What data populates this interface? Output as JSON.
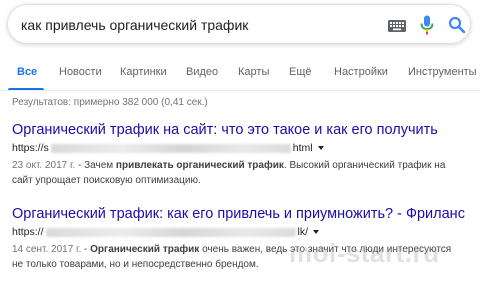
{
  "search": {
    "query": "как привлечь органический трафик",
    "icons": [
      "keyboard-icon",
      "microphone-icon",
      "search-icon"
    ]
  },
  "tabs": [
    {
      "label": "Все",
      "active": true
    },
    {
      "label": "Новости"
    },
    {
      "label": "Картинки"
    },
    {
      "label": "Видео"
    },
    {
      "label": "Карты"
    },
    {
      "label": "Ещё"
    },
    {
      "label": "Настройки"
    },
    {
      "label": "Инструменты"
    }
  ],
  "stats": "Результатов: примерно 382 000 (0,41 сек.)",
  "results": [
    {
      "title": "Органический трафик на сайт: что это такое и как его получить",
      "url_start": "https://s",
      "url_end": "html",
      "date": "23 окт. 2017 г.",
      "snippet_pre": " - Зачем ",
      "snippet_bold": "привлекать органический трафик",
      "snippet_post": ". Высокий органический трафик на сайт упрощает поисковую оптимизацию."
    },
    {
      "title": "Органический трафик: как его привлечь и приумножить? - Фриланс",
      "url_start": "https://",
      "url_end": "lk/",
      "date": "14 сент. 2017 г.",
      "snippet_pre": " - ",
      "snippet_bold": "Органический трафик",
      "snippet_post": " очень важен, ведь это значит что люди интересуются не только товарами, но и непосредственно брендом."
    }
  ],
  "watermark": "moi-start.ru",
  "colors": {
    "link": "#1a0dab",
    "accent": "#1a73e8"
  }
}
